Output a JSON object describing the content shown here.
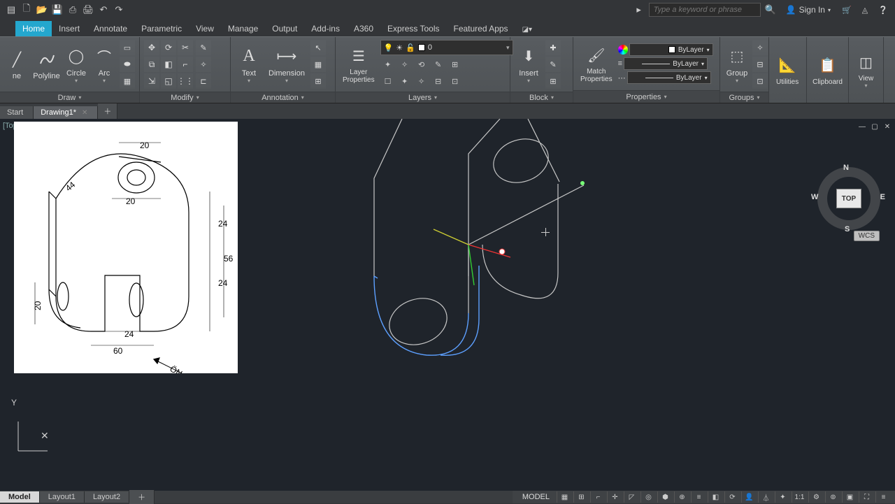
{
  "qat": {
    "search_placeholder": "Type a keyword or phrase",
    "signin": "Sign In"
  },
  "tabs": [
    "Home",
    "Insert",
    "Annotate",
    "Parametric",
    "View",
    "Manage",
    "Output",
    "Add-ins",
    "A360",
    "Express Tools",
    "Featured Apps"
  ],
  "ribbon": {
    "draw": {
      "title": "Draw",
      "line": "ne",
      "polyline": "Polyline",
      "circle": "Circle",
      "arc": "Arc"
    },
    "modify": {
      "title": "Modify"
    },
    "annotation": {
      "title": "Annotation",
      "text": "Text",
      "dim": "Dimension"
    },
    "layers": {
      "title": "Layers",
      "lp": "Layer\nProperties",
      "current": "0"
    },
    "block": {
      "title": "Block",
      "insert": "Insert"
    },
    "properties": {
      "title": "Properties",
      "match": "Match\nProperties",
      "bylayer": "ByLayer"
    },
    "groups": {
      "title": "Groups",
      "group": "Group"
    },
    "utilities": {
      "title": "Utilities"
    },
    "clipboard": {
      "title": "Clipboard"
    },
    "view": {
      "title": "View"
    }
  },
  "file_tabs": {
    "start": "Start",
    "drawing": "Drawing1*"
  },
  "viewport": {
    "label": "[Top",
    "cube": "TOP",
    "wcs": "WCS",
    "n": "N",
    "s": "S",
    "e": "E",
    "w": "W",
    "y": "Y",
    "x": "✕"
  },
  "layout": {
    "model": "Model",
    "l1": "Layout1",
    "l2": "Layout2"
  },
  "status": {
    "model": "MODEL",
    "scale": "1:1"
  },
  "ref": {
    "dims": {
      "d20a": "20",
      "d20b": "20",
      "d20c": "20",
      "d44": "44",
      "d24a": "24",
      "d24b": "24",
      "d24c": "24",
      "d56": "56",
      "d60": "60"
    },
    "front": "ÖN"
  }
}
